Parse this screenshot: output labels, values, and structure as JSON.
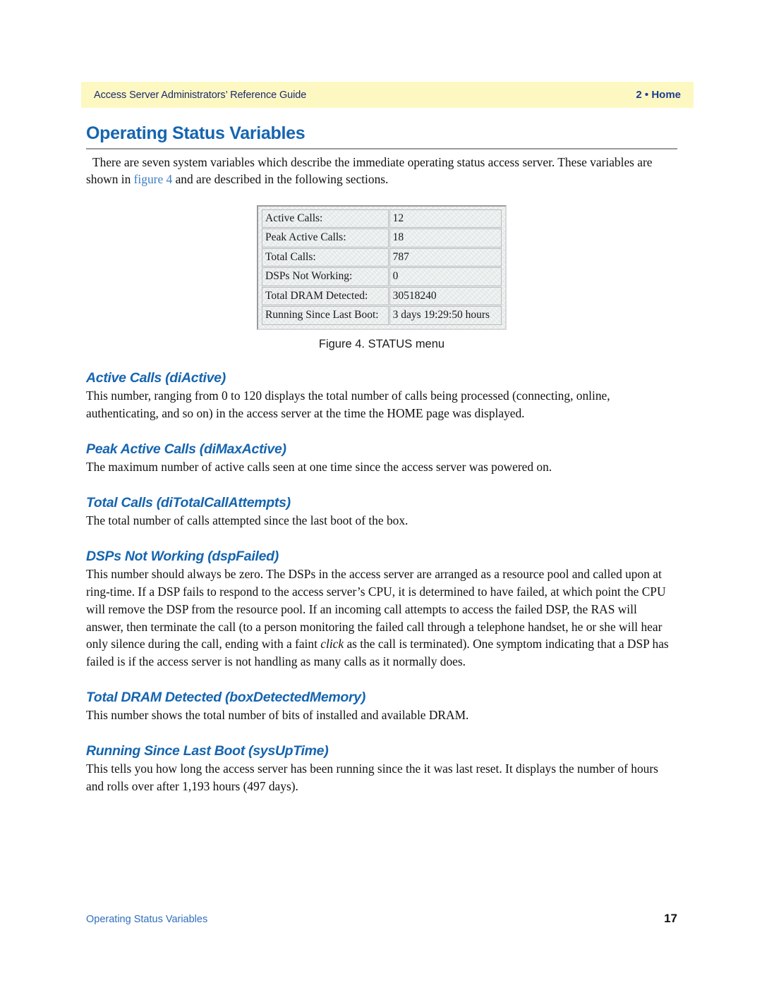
{
  "header": {
    "title": "Access Server Administrators’ Reference Guide",
    "chapter": "2 • Home"
  },
  "page": {
    "title": "Operating Status Variables",
    "intro_part1": "There are seven system variables which describe the immediate operating status access server. These variables are shown in ",
    "intro_link": "figure 4",
    "intro_part2": " and are described in the following sections."
  },
  "figure": {
    "caption": "Figure 4. STATUS menu",
    "rows": [
      {
        "label": "Active Calls:",
        "value": "12"
      },
      {
        "label": "Peak Active Calls:",
        "value": "18"
      },
      {
        "label": "Total Calls:",
        "value": "787"
      },
      {
        "label": "DSPs Not Working:",
        "value": "0"
      },
      {
        "label": "Total DRAM Detected:",
        "value": "30518240"
      },
      {
        "label": "Running Since Last Boot:",
        "value": "3 days 19:29:50 hours"
      }
    ]
  },
  "sections": [
    {
      "heading": "Active Calls (diActive)",
      "body": "This number, ranging from 0 to 120 displays the total number of calls being processed (connecting, online, authenticating, and so on) in the access server at the time the HOME page was displayed."
    },
    {
      "heading": "Peak Active Calls (diMaxActive)",
      "body": "The maximum number of active calls seen at one time since the access server was powered on."
    },
    {
      "heading": "Total Calls (diTotalCallAttempts)",
      "body": "The total number of calls attempted since the last boot of the box."
    },
    {
      "heading": "DSPs Not Working (dspFailed)",
      "body_part1": "This number should always be zero. The DSPs in the access server are arranged as a resource pool and called upon at ring-time. If a DSP fails to respond to the access server’s CPU, it is determined to have failed, at which point the CPU will remove the DSP from the resource pool. If an incoming call attempts to access the failed DSP, the RAS will answer, then terminate the call (to a person monitoring the failed call through a telephone handset, he or she will hear only silence during the call, ending with a faint ",
      "body_italic": "click",
      "body_part2": " as the call is terminated). One symptom indicating that a DSP has failed is if the access server is not handling as many calls as it normally does."
    },
    {
      "heading": "Total DRAM Detected (boxDetectedMemory)",
      "body": "This number shows the total number of bits of installed and available DRAM."
    },
    {
      "heading": "Running Since Last Boot (sysUpTime)",
      "body": "This tells you how long the access server has been running since the it was last reset. It displays the number of hours and rolls over after 1,193 hours (497 days)."
    }
  ],
  "footer": {
    "left": "Operating Status Variables",
    "page_number": "17"
  },
  "colors": {
    "header_band": "#fdf8c2",
    "heading_blue": "#1565b0",
    "chapter_blue": "#1e3d8f",
    "link_blue": "#3b7cc4",
    "rule_gray": "#9a9a9a"
  }
}
